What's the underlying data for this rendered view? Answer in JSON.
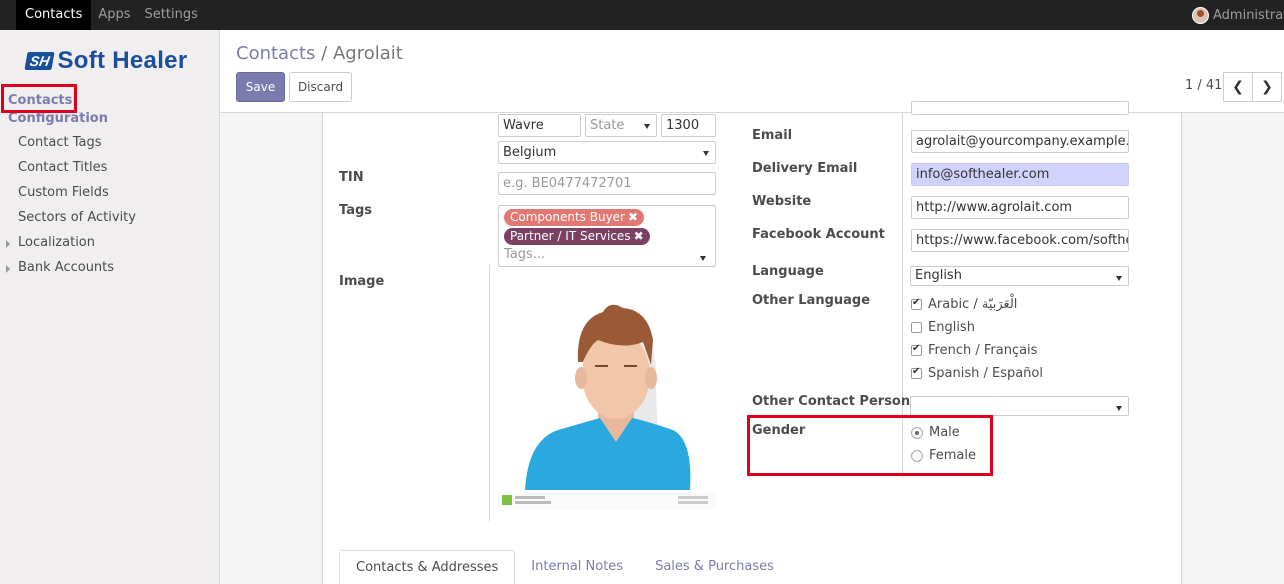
{
  "topbar": {
    "menu": [
      "Contacts",
      "Apps",
      "Settings"
    ],
    "user": "Administrator"
  },
  "sidebar": {
    "logo_mark": "SH",
    "logo_text": "Soft Healer",
    "section_contacts": "Contacts",
    "section_configuration": "Configuration",
    "items": [
      "Contact Tags",
      "Contact Titles",
      "Custom Fields",
      "Sectors of Activity",
      "Localization",
      "Bank Accounts"
    ]
  },
  "control_panel": {
    "breadcrumb_root": "Contacts",
    "breadcrumb_sep": "/",
    "breadcrumb_current": "Agrolait",
    "save": "Save",
    "discard": "Discard",
    "pager": "1 / 41"
  },
  "form": {
    "city": "Wavre",
    "state_placeholder": "State",
    "zip": "1300",
    "country": "Belgium",
    "tin_label": "TIN",
    "tin_placeholder": "e.g. BE0477472701",
    "tags_label": "Tags",
    "tags": [
      {
        "label": "Components Buyer",
        "color": "#e27873"
      },
      {
        "label": "Partner / IT Services",
        "color": "#7b4062"
      }
    ],
    "tags_placeholder": "Tags...",
    "image_label": "Image",
    "email_label": "Email",
    "email": "agrolait@yourcompany.example.com",
    "delivery_email_label": "Delivery Email",
    "delivery_email": "info@softhealer.com",
    "website_label": "Website",
    "website": "http://www.agrolait.com",
    "facebook_label": "Facebook Account",
    "facebook": "https://www.facebook.com/softhealer",
    "language_label": "Language",
    "language": "English",
    "other_language_label": "Other Language",
    "other_languages": [
      {
        "label": "Arabic / الْعَرَبيّة",
        "checked": true
      },
      {
        "label": "English",
        "checked": false
      },
      {
        "label": "French / Français",
        "checked": true
      },
      {
        "label": "Spanish / Español",
        "checked": true
      }
    ],
    "other_contact_label": "Other Contact Person",
    "other_contact": "",
    "gender_label": "Gender",
    "gender_options": [
      {
        "label": "Male",
        "selected": true
      },
      {
        "label": "Female",
        "selected": false
      }
    ]
  },
  "tabs": [
    "Contacts & Addresses",
    "Internal Notes",
    "Sales & Purchases"
  ],
  "colors": {
    "accent": "#7c7bad",
    "topbar": "#222222",
    "highlight": "#e0001b",
    "delivery_bg": "#d2d2ff"
  }
}
